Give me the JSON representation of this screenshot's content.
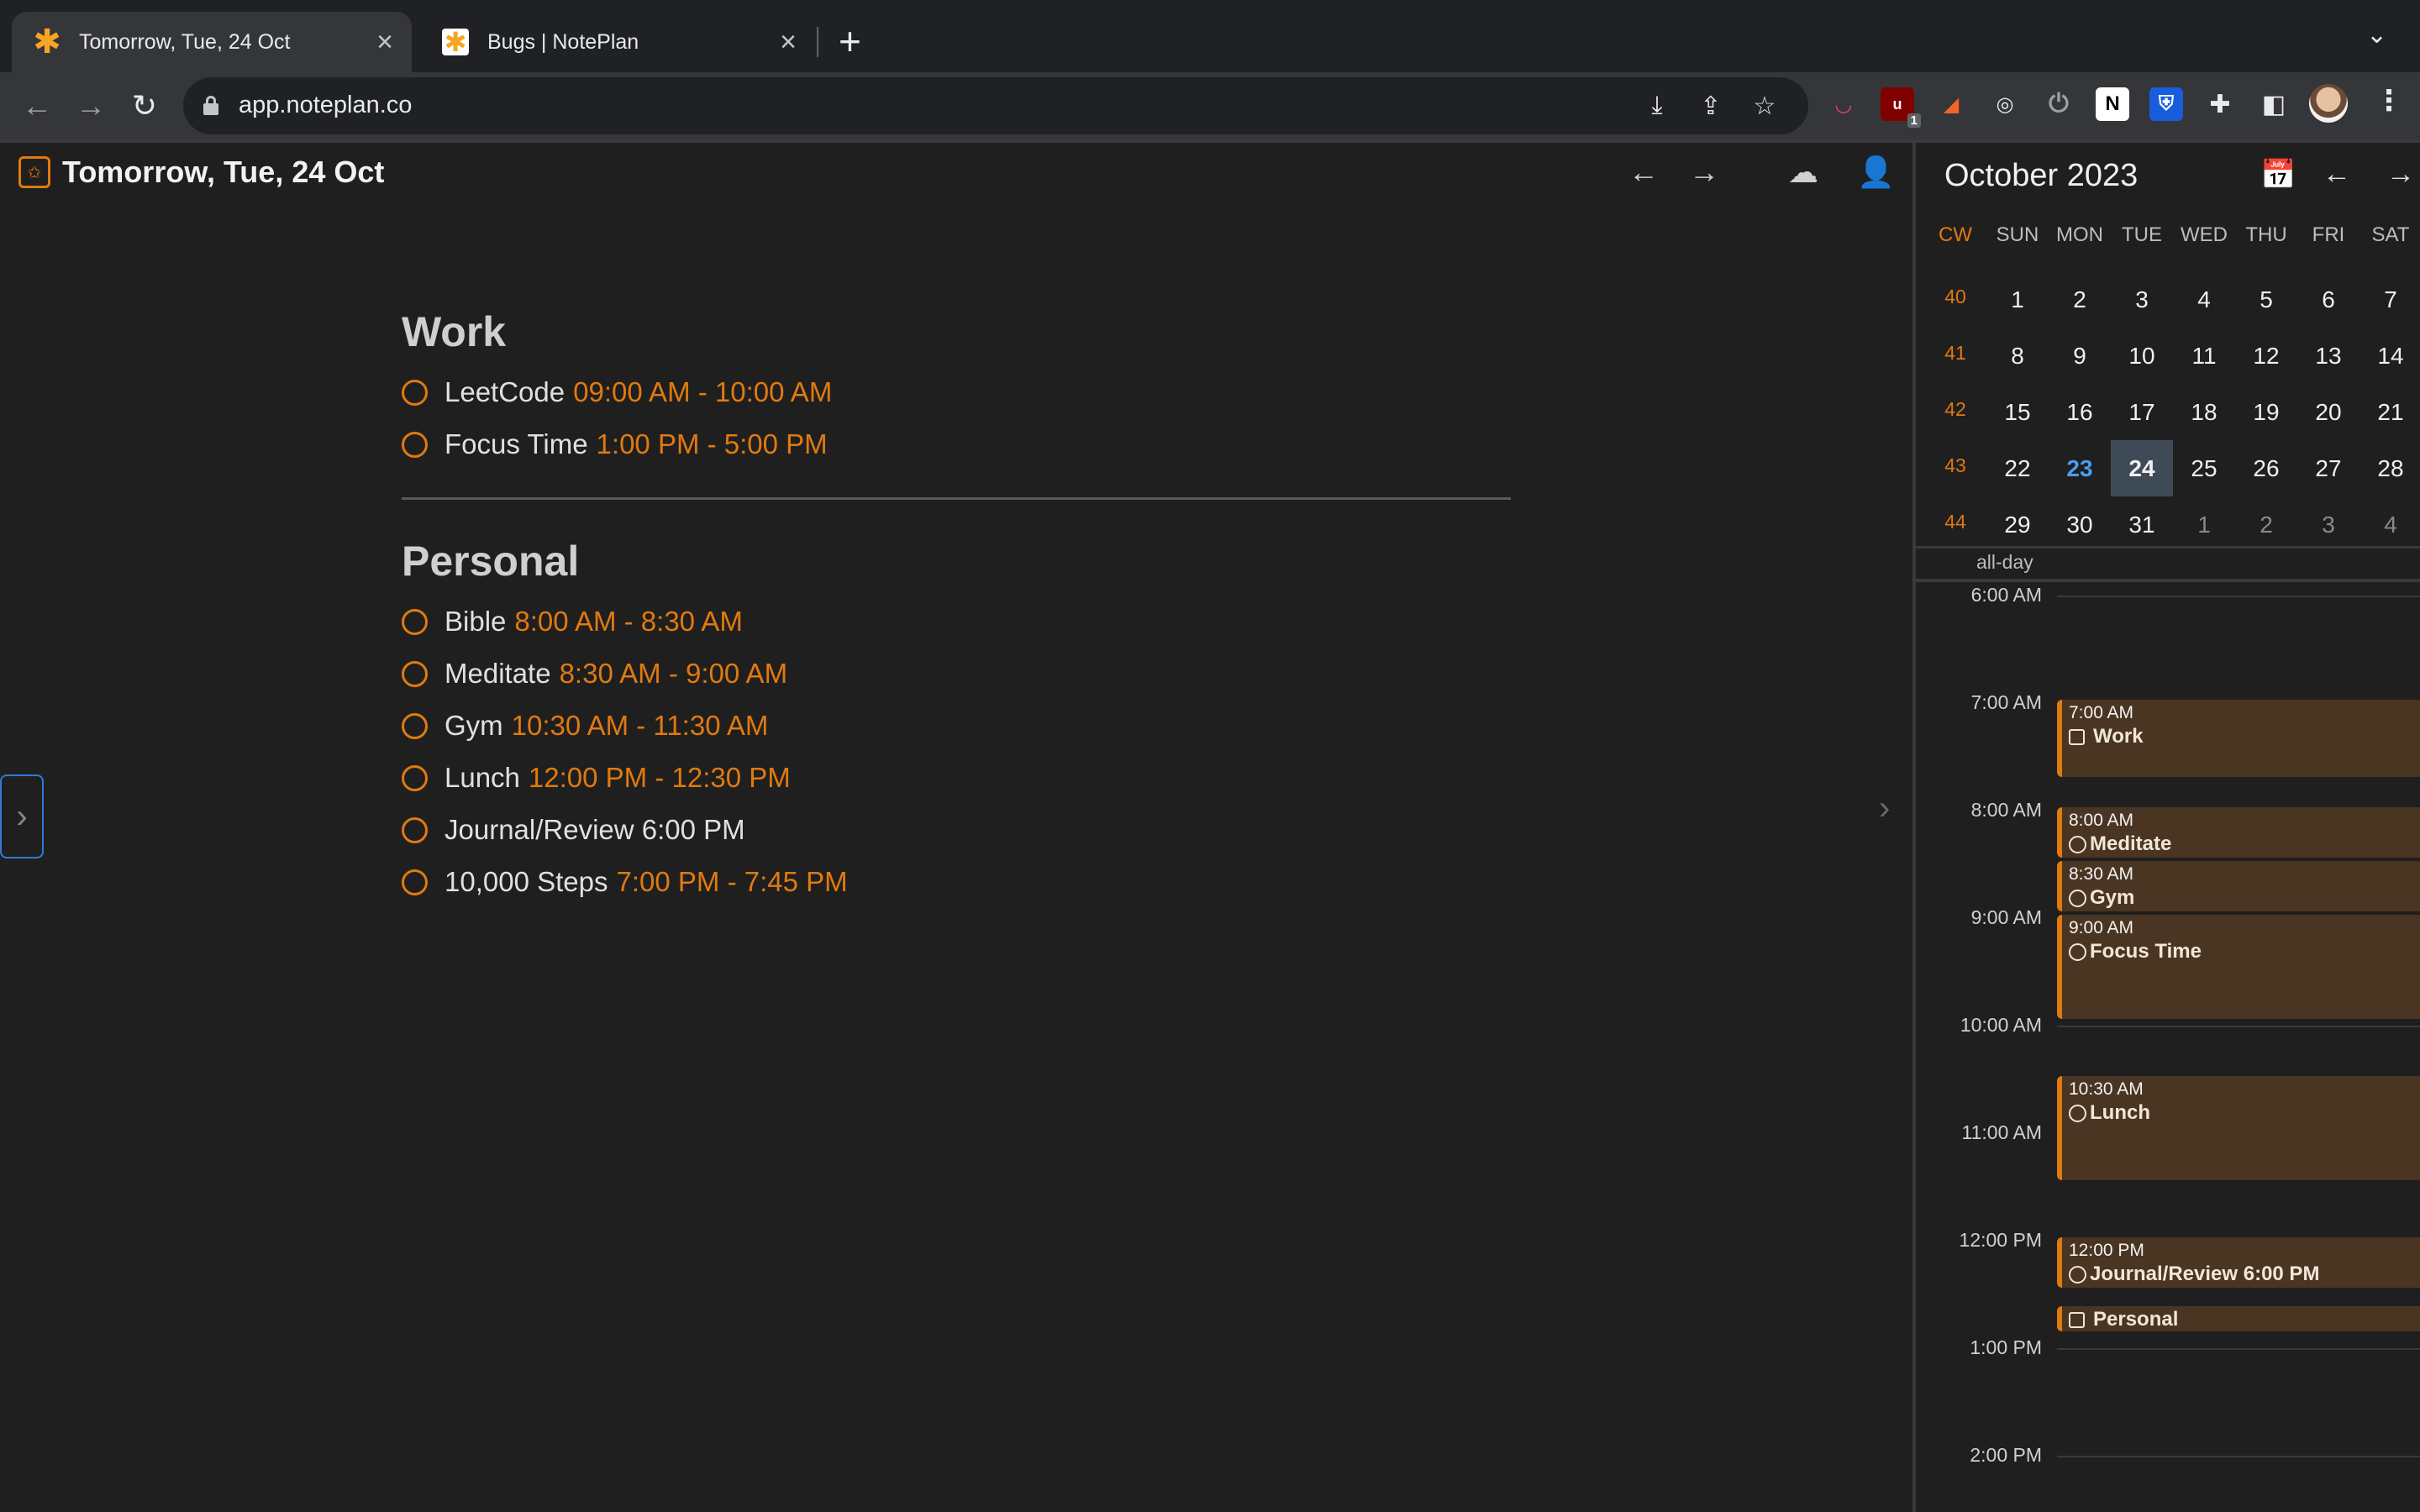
{
  "browser": {
    "tabs": [
      {
        "title": "Tomorrow, Tue, 24 Oct",
        "favicon": "asterisk-icon"
      },
      {
        "title": "Bugs | NotePlan",
        "favicon": "noteplan-icon"
      }
    ],
    "url": "app.noteplan.co",
    "extension_badge": "1"
  },
  "main": {
    "title": "Tomorrow, Tue, 24 Oct",
    "sections": [
      {
        "heading": "Work",
        "tasks": [
          {
            "label": "LeetCode",
            "time": "09:00 AM - 10:00 AM"
          },
          {
            "label": "Focus Time",
            "time": "1:00 PM - 5:00 PM"
          }
        ]
      },
      {
        "heading": "Personal",
        "tasks": [
          {
            "label": "Bible",
            "time": "8:00 AM - 8:30 AM"
          },
          {
            "label": "Meditate",
            "time": "8:30 AM - 9:00 AM"
          },
          {
            "label": "Gym",
            "time": "10:30 AM - 11:30 AM"
          },
          {
            "label": "Lunch",
            "time": "12:00 PM - 12:30 PM"
          },
          {
            "label": "Journal/Review 6:00 PM",
            "time": ""
          },
          {
            "label": "10,000 Steps",
            "time": "7:00 PM - 7:45 PM"
          }
        ]
      }
    ]
  },
  "calendar": {
    "month_title": "October 2023",
    "headers": [
      "CW",
      "SUN",
      "MON",
      "TUE",
      "WED",
      "THU",
      "FRI",
      "SAT"
    ],
    "weeks": [
      {
        "cw": "40",
        "days": [
          "1",
          "2",
          "3",
          "4",
          "5",
          "6",
          "7"
        ]
      },
      {
        "cw": "41",
        "days": [
          "8",
          "9",
          "10",
          "11",
          "12",
          "13",
          "14"
        ]
      },
      {
        "cw": "42",
        "days": [
          "15",
          "16",
          "17",
          "18",
          "19",
          "20",
          "21"
        ]
      },
      {
        "cw": "43",
        "days": [
          "22",
          "23",
          "24",
          "25",
          "26",
          "27",
          "28"
        ]
      },
      {
        "cw": "44",
        "days": [
          "29",
          "30",
          "31",
          "1",
          "2",
          "3",
          "4"
        ]
      }
    ],
    "today": "23",
    "selected": "24",
    "all_day_label": "all-day",
    "hours": [
      "6:00 AM",
      "7:00 AM",
      "8:00 AM",
      "9:00 AM",
      "10:00 AM",
      "11:00 AM",
      "12:00 PM",
      "1:00 PM",
      "2:00 PM"
    ],
    "events": [
      {
        "time": "7:00 AM",
        "title": "Work",
        "marker": "box"
      },
      {
        "time": "8:00 AM",
        "title": "Meditate",
        "marker": "circle"
      },
      {
        "time": "8:30 AM",
        "title": "Gym",
        "marker": "circle"
      },
      {
        "time": "9:00 AM",
        "title": "Focus Time",
        "marker": "circle"
      },
      {
        "time": "10:30 AM",
        "title": "Lunch",
        "marker": "circle"
      },
      {
        "time": "12:00 PM",
        "title": "Journal/Review 6:00 PM",
        "marker": "circle"
      },
      {
        "time": "",
        "title": "Personal",
        "marker": "box"
      }
    ]
  },
  "colors": {
    "accent": "#e07a10",
    "today": "#4a9df0",
    "background": "#1f1f1f"
  }
}
